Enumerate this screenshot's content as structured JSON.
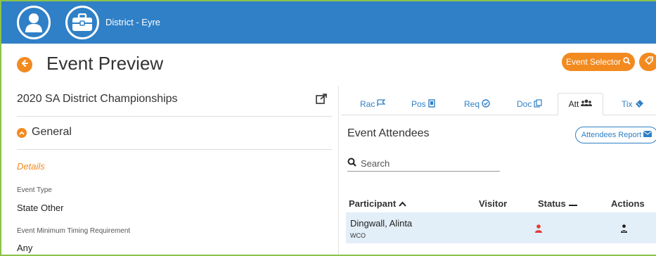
{
  "header": {
    "district_label": "District - Eyre",
    "icons": [
      "user-icon",
      "briefcase-icon"
    ]
  },
  "page": {
    "title": "Event Preview",
    "event_selector_label": "Event Selector",
    "event_name": "2020 SA District Championships"
  },
  "general": {
    "section_label": "General",
    "subsection_label": "Details",
    "fields": [
      {
        "label": "Event Type",
        "value": "State Other"
      },
      {
        "label": "Event Minimum Timing Requirement",
        "value": "Any"
      }
    ]
  },
  "tabs": [
    {
      "label": "Rac",
      "icon": "flag-icon"
    },
    {
      "label": "Pos",
      "icon": "badge-icon"
    },
    {
      "label": "Req",
      "icon": "check-circle-icon"
    },
    {
      "label": "Doc",
      "icon": "documents-icon"
    },
    {
      "label": "Att",
      "icon": "users-icon",
      "active": true
    },
    {
      "label": "Tix",
      "icon": "ticket-icon"
    }
  ],
  "attendees": {
    "title": "Event Attendees",
    "report_label": "Attendees Report",
    "search_placeholder": "Search",
    "columns": [
      "Participant",
      "Visitor",
      "Status",
      "Actions"
    ],
    "rows": [
      {
        "participant": "Dingwall, Alinta",
        "club": "WCO",
        "visitor": "",
        "status_icon": "user-icon",
        "action_icon": "user-lock-icon"
      }
    ]
  },
  "colors": {
    "header_blue": "#2f80c6",
    "accent_orange": "#f28a1f",
    "status_red": "#e53935",
    "row_highlight": "#e2eef8",
    "frame_green": "#8bc34a"
  }
}
